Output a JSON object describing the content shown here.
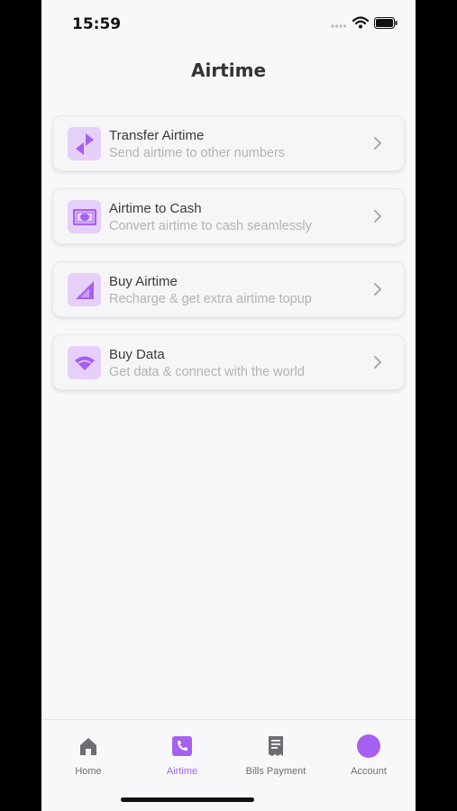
{
  "status_bar": {
    "time": "15:59"
  },
  "header": {
    "title": "Airtime"
  },
  "menu": [
    {
      "title": "Transfer Airtime",
      "subtitle": "Send airtime to other numbers",
      "icon": "transfer-icon"
    },
    {
      "title": "Airtime to Cash",
      "subtitle": "Convert airtime to cash seamlessly",
      "icon": "cash-icon"
    },
    {
      "title": "Buy Airtime",
      "subtitle": "Recharge & get extra airtime topup",
      "icon": "signal-icon"
    },
    {
      "title": "Buy Data",
      "subtitle": "Get data & connect with the world",
      "icon": "wifi-icon"
    }
  ],
  "tabs": [
    {
      "label": "Home",
      "icon": "home-icon",
      "active": false
    },
    {
      "label": "Airtime",
      "icon": "phone-icon",
      "active": true
    },
    {
      "label": "Bills Payment",
      "icon": "receipt-icon",
      "active": false
    },
    {
      "label": "Account",
      "icon": "avatar-icon",
      "active": false
    }
  ],
  "colors": {
    "accent": "#a560f0",
    "icon_bg": "#e6cff9",
    "icon_fg": "#a560f0",
    "background": "#f8f8fa"
  }
}
